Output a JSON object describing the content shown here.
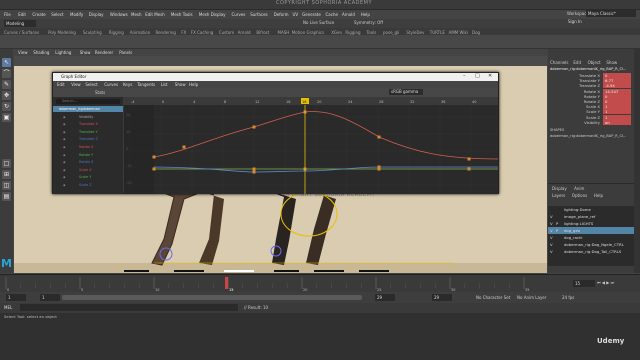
{
  "watermark_top": "COPYRIGHT SOPHORIA ACADEMY",
  "watermark_mid": "COPYRIGHT SOPHORIA ACADEMY",
  "main_menu": [
    "File",
    "Edit",
    "Create",
    "Select",
    "Modify",
    "Display",
    "Windows",
    "Mesh",
    "Edit Mesh",
    "Mesh Tools",
    "Mesh Display",
    "Curves",
    "Surfaces",
    "Deform",
    "UV",
    "Generate",
    "Cache",
    "Arnold",
    "Help"
  ],
  "workspace_label": "Workspace:",
  "workspace_value": "Maya Classic*",
  "mode_select": "Modeling",
  "live_surface": "No Live Surface",
  "symmetry": "Symmetry: Off",
  "sign_in": "Sign In",
  "shelf_tabs": [
    "Curves / Surfaces",
    "Poly Modeling",
    "Sculpting",
    "Rigging",
    "Animation",
    "Rendering",
    "FX",
    "FX Caching",
    "Custom",
    "Arnold",
    "Bifrost",
    "MASH",
    "Motion Graphics",
    "XGen",
    "Rigging",
    "Tools",
    "pose_gli",
    "StyleDev",
    "TURTLE",
    "AMM Wiki",
    "Dog"
  ],
  "viewport_menu": [
    "View",
    "Shading",
    "Lighting",
    "Show",
    "Renderer",
    "Panels"
  ],
  "graph_editor": {
    "title": "Graph Editor",
    "menu": [
      "Edit",
      "View",
      "Select",
      "Curves",
      "Keys",
      "Tangents",
      "List",
      "Show",
      "Help"
    ],
    "stats": "Stats",
    "color_space": "sRGB gamma",
    "search_placeholder": "Search...",
    "outliner_items": [
      {
        "label": "doberman_rigdoberman",
        "color": "#8fb0ff",
        "selected": true
      },
      {
        "label": "Visibility",
        "color": "#aaa"
      },
      {
        "label": "Translate X",
        "color": "#d05050"
      },
      {
        "label": "Translate Y",
        "color": "#50b050"
      },
      {
        "label": "Translate Z",
        "color": "#5070d0"
      },
      {
        "label": "Rotate X",
        "color": "#d05050"
      },
      {
        "label": "Rotate Y",
        "color": "#50b050"
      },
      {
        "label": "Rotate Z",
        "color": "#5070d0"
      },
      {
        "label": "Scale X",
        "color": "#d05050"
      },
      {
        "label": "Scale Y",
        "color": "#50b050"
      },
      {
        "label": "Scale Z",
        "color": "#5070d0"
      }
    ],
    "frame_ticks": [
      "-4",
      "0",
      "4",
      "8",
      "12",
      "16",
      "20",
      "24",
      "28",
      "32",
      "36",
      "40"
    ],
    "value_ticks": [
      "20",
      "10",
      "0",
      "-10",
      "-20"
    ],
    "current_frame": "16"
  },
  "channel_box": {
    "tabs": [
      "Channels",
      "Edit",
      "Object",
      "Show"
    ],
    "object_name": "doberman_rig:dobermanIK_rig_BAP_R_Cl...",
    "channels": [
      {
        "label": "Translate X",
        "value": "0"
      },
      {
        "label": "Translate Y",
        "value": "6.77"
      },
      {
        "label": "Translate Z",
        "value": "-4.94"
      },
      {
        "label": "Rotate X",
        "value": "14.347"
      },
      {
        "label": "Rotate Y",
        "value": "0"
      },
      {
        "label": "Rotate Z",
        "value": "0"
      },
      {
        "label": "Scale X",
        "value": "1"
      },
      {
        "label": "Scale Y",
        "value": "1"
      },
      {
        "label": "Scale Z",
        "value": "1"
      },
      {
        "label": "Visibility",
        "value": "on"
      }
    ],
    "shapes_header": "SHAPES",
    "shape_name": "doberman_rig:dobermanIK_rig_BAP_R_CI..."
  },
  "layer_editor": {
    "tabs": [
      "Display",
      "Anim"
    ],
    "menu": [
      "Layers",
      "Options",
      "Help"
    ],
    "layers": [
      {
        "label": "lighting:Dome",
        "v": "",
        "p": ""
      },
      {
        "label": "image_plane_ref",
        "v": "V",
        "p": ""
      },
      {
        "label": "lighting:LIGHTS",
        "v": "V",
        "p": "P"
      },
      {
        "label": "dog_geo",
        "v": "V",
        "p": "P"
      },
      {
        "label": "dog_rachi",
        "v": "V",
        "p": ""
      },
      {
        "label": "doberman_rig:Dog_Ngele_CTRL",
        "v": "V",
        "p": ""
      },
      {
        "label": "doberman_rig:Dog_Tail_CTRLS",
        "v": "V",
        "p": ""
      }
    ]
  },
  "timeline": {
    "ticks": [
      "0",
      "5",
      "10",
      "15",
      "20",
      "25",
      "30",
      "35"
    ],
    "current": "15",
    "current_field": "15"
  },
  "range": {
    "start": "1",
    "start2": "1",
    "end": "29",
    "end2": "29",
    "char_set": "No Character Set",
    "anim_layer": "No Anim Layer",
    "fps": "24 fps"
  },
  "command": {
    "mel": "MEL",
    "result": "// Result: 10",
    "help": "Select Tool: select an object"
  },
  "udemy": "Udemy",
  "colors": {
    "red_curve": "#d06050",
    "green_curve": "#8ab04a",
    "blue_curve": "#5a8ad0",
    "playhead": "#e8c000",
    "ui_bg": "#444444",
    "panel_bg": "#3c3c3c"
  }
}
